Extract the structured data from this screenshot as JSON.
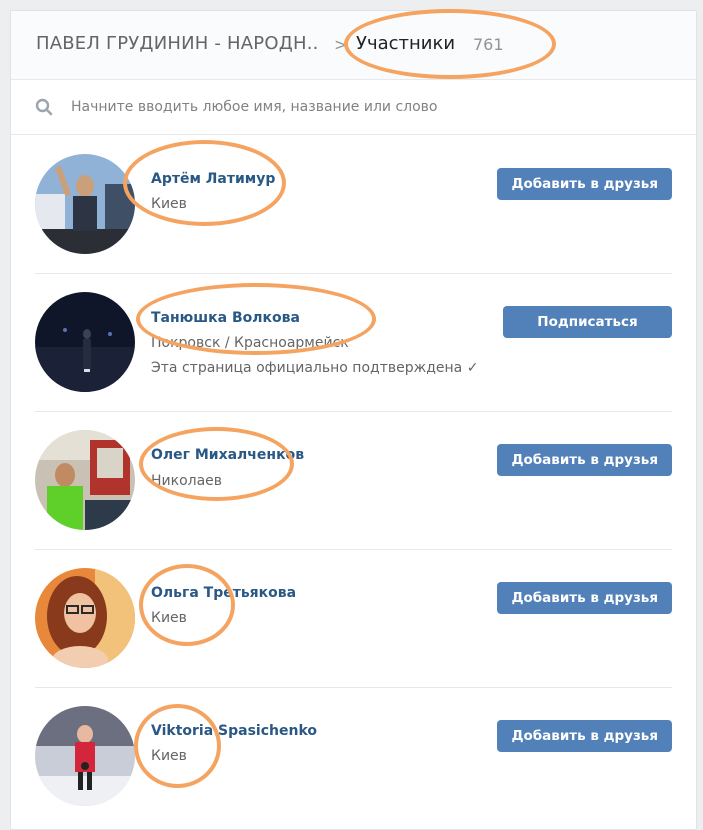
{
  "header": {
    "community_title": "ПАВЕЛ ГРУДИНИН - НАРОДН..",
    "separator": ">",
    "current": "Участники",
    "count": "761"
  },
  "search": {
    "placeholder": "Начните вводить любое имя, название или слово",
    "icon": "search-icon"
  },
  "members": [
    {
      "name": "Артём Латимур",
      "city": "Киев",
      "note": "",
      "button": "Добавить в друзья"
    },
    {
      "name": "Танюшка Волкова",
      "city": "Покровск / Красноармейск",
      "note": "Эта страница официально подтверждена ✓",
      "button": "Подписаться"
    },
    {
      "name": "Олег Михалченков",
      "city": "Николаев",
      "note": "",
      "button": "Добавить в друзья"
    },
    {
      "name": "Ольга Третьякова",
      "city": "Киев",
      "note": "",
      "button": "Добавить в друзья"
    },
    {
      "name": "Viktoria Spasichenko",
      "city": "Киев",
      "note": "",
      "button": "Добавить в друзья"
    }
  ],
  "colors": {
    "link": "#2a5885",
    "button": "#5181b8",
    "highlight": "#f4a460"
  }
}
